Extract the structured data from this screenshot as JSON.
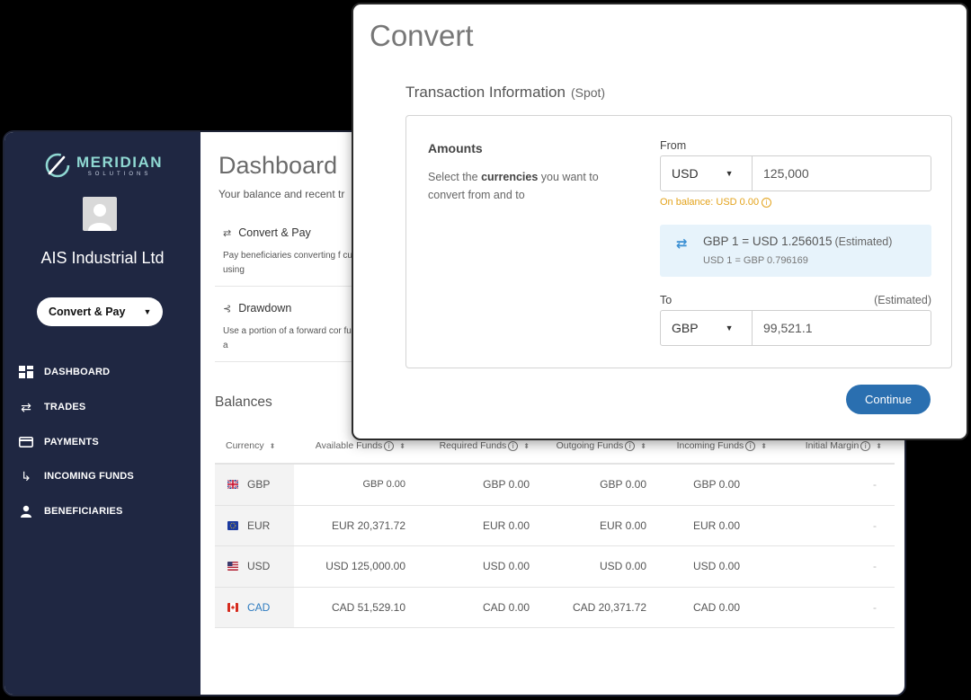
{
  "brand": {
    "name": "MERIDIAN",
    "sub": "SOLUTIONS",
    "accent": "#8fd8d2"
  },
  "sidebar": {
    "company": "AIS Industrial Ltd",
    "action_button": "Convert & Pay",
    "nav": [
      {
        "label": "DASHBOARD",
        "icon": "dashboard-grid-icon"
      },
      {
        "label": "TRADES",
        "icon": "swap-arrows-icon"
      },
      {
        "label": "PAYMENTS",
        "icon": "credit-card-icon"
      },
      {
        "label": "INCOMING FUNDS",
        "icon": "incoming-arrow-icon"
      },
      {
        "label": "BENEFICIARIES",
        "icon": "person-icon"
      }
    ]
  },
  "dashboard": {
    "title": "Dashboard",
    "subtitle": "Your balance and recent tr",
    "cards": [
      {
        "title": "Convert & Pay",
        "body": "Pay beneficiaries converting f currencies, ie. Pay USD using"
      },
      {
        "title": "Drawdown",
        "body": "Use a portion of a forward cor funds to a balance or to pay a"
      }
    ],
    "balances_title": "Balances",
    "table": {
      "headers": [
        "Currency",
        "Available Funds",
        "Required Funds",
        "Outgoing Funds",
        "Incoming Funds",
        "Initial Margin"
      ],
      "rows": [
        {
          "currency": "GBP",
          "available": "GBP 0.00",
          "required": "GBP 0.00",
          "outgoing": "GBP 0.00",
          "incoming": "GBP 0.00",
          "margin": "-"
        },
        {
          "currency": "EUR",
          "available": "EUR 20,371.72",
          "required": "EUR 0.00",
          "outgoing": "EUR 0.00",
          "incoming": "EUR 0.00",
          "margin": "-"
        },
        {
          "currency": "USD",
          "available": "USD 125,000.00",
          "required": "USD 0.00",
          "outgoing": "USD 0.00",
          "incoming": "USD 0.00",
          "margin": "-"
        },
        {
          "currency": "CAD",
          "available": "CAD 51,529.10",
          "required": "CAD 0.00",
          "outgoing": "CAD 20,371.72",
          "incoming": "CAD 0.00",
          "margin": "-"
        }
      ]
    }
  },
  "convert": {
    "title": "Convert",
    "section_title": "Transaction Information",
    "section_tag": "(Spot)",
    "amounts_title": "Amounts",
    "amounts_desc_pre": "Select the ",
    "amounts_desc_bold": "currencies",
    "amounts_desc_post": " you want to convert from and to",
    "from_label": "From",
    "from_currency": "USD",
    "from_amount": "125,000",
    "balance_note": "On balance: USD 0.00",
    "rate_main": "GBP 1 = USD 1.256015",
    "rate_estimated": "(Estimated)",
    "rate_sub": "USD 1 = GBP 0.796169",
    "to_label": "To",
    "to_estimated": "(Estimated)",
    "to_currency": "GBP",
    "to_amount": "99,521.1",
    "continue_label": "Continue"
  }
}
